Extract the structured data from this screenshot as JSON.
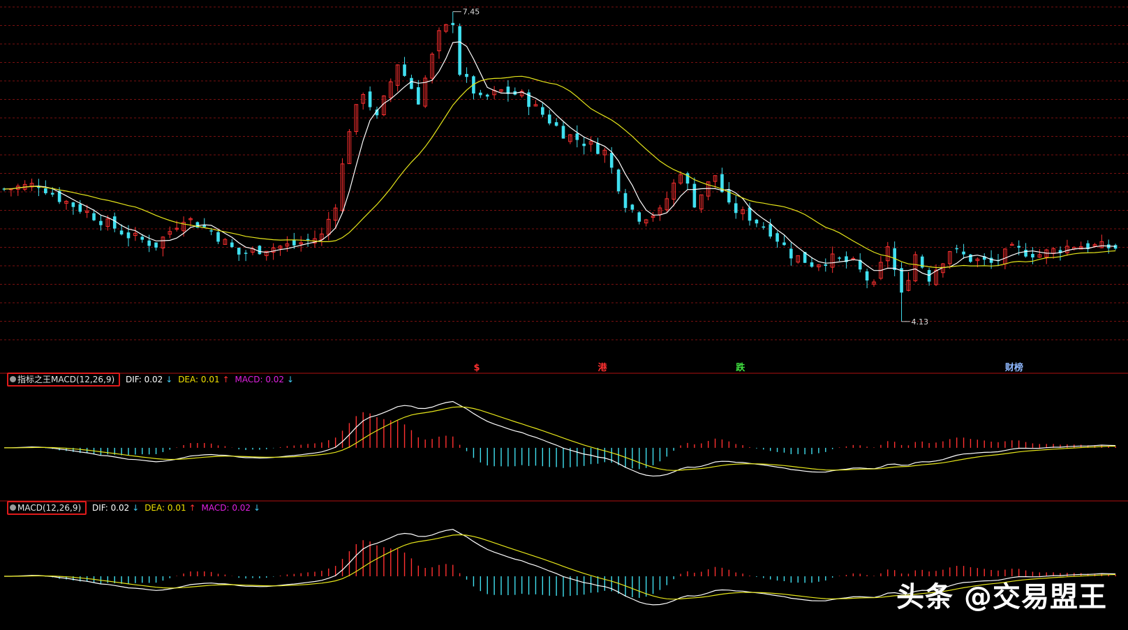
{
  "chart_data": [
    {
      "type": "candlestick",
      "title": "",
      "ylim": [
        3.8,
        7.5
      ],
      "price_high_label": "7.45",
      "price_low_label": "4.13",
      "grid": true,
      "event_markers": [
        {
          "label": "$",
          "color": "#ff3030",
          "index": 68
        },
        {
          "label": "港",
          "color": "#ff3030",
          "index": 86
        },
        {
          "label": "跌",
          "color": "#40e040",
          "index": 106
        },
        {
          "label": "财榜",
          "color": "#8fb8ff",
          "index": 145
        }
      ],
      "ma_lines": [
        {
          "color": "#ffffff"
        },
        {
          "color": "#e6e61a"
        }
      ],
      "colors": {
        "up": "#ff3030",
        "down": "#40e0f0",
        "grid": "#7a1010",
        "background": "#000000"
      }
    },
    {
      "type": "bar+line",
      "indicator": "指标之王MACD(12,26,9)",
      "values_text": {
        "dif": "DIF: 0.02",
        "dea": "DEA: 0.01",
        "macd": "MACD: 0.02"
      },
      "arrows": {
        "dif": "↓",
        "dea": "↑",
        "macd": "↓"
      }
    },
    {
      "type": "bar+line",
      "indicator": "MACD(12,26,9)",
      "values_text": {
        "dif": "DIF: 0.02",
        "dea": "DEA: 0.01",
        "macd": "MACD: 0.02"
      },
      "arrows": {
        "dif": "↓",
        "dea": "↑",
        "macd": "↓"
      }
    }
  ],
  "watermark": "头条 @交易盟王"
}
